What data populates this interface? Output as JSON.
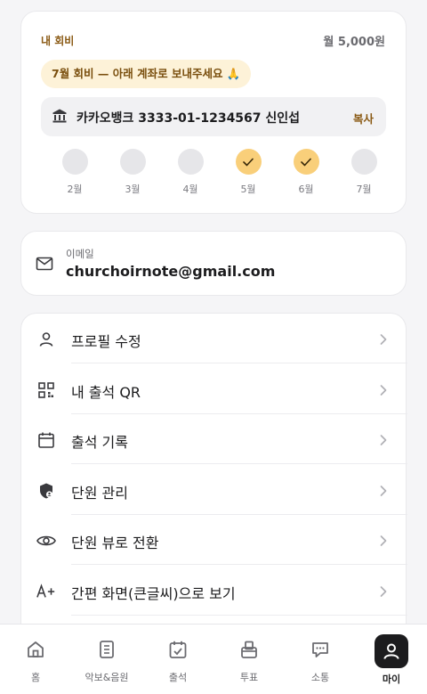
{
  "dues": {
    "title": "내 회비",
    "amount": "월 5,000원",
    "notice": "7월 회비 — 아래 계좌로 보내주세요 🙏",
    "account": "카카오뱅크 3333-01-1234567 신인섭",
    "copy_label": "복사",
    "months": [
      {
        "label": "2월",
        "paid": false
      },
      {
        "label": "3월",
        "paid": false
      },
      {
        "label": "4월",
        "paid": false
      },
      {
        "label": "5월",
        "paid": true
      },
      {
        "label": "6월",
        "paid": true
      },
      {
        "label": "7월",
        "paid": false
      }
    ],
    "accent_color": "#8a5a14",
    "paid_color": "#f9cf7a"
  },
  "email": {
    "label": "이메일",
    "value": "churchoirnote@gmail.com"
  },
  "menu": [
    {
      "label": "프로필 수정",
      "icon": "person-icon"
    },
    {
      "label": "내 출석 QR",
      "icon": "qr-code-icon"
    },
    {
      "label": "출석 기록",
      "icon": "calendar-icon"
    },
    {
      "label": "단원 관리",
      "icon": "shield-user-icon"
    },
    {
      "label": "단원 뷰로 전환",
      "icon": "eye-icon"
    },
    {
      "label": "간편 화면(큰글씨)으로 보기",
      "icon": "text-size-icon"
    }
  ],
  "tabs": [
    {
      "label": "홈",
      "icon": "home-icon"
    },
    {
      "label": "악보&음원",
      "icon": "score-book-icon"
    },
    {
      "label": "출석",
      "icon": "calendar-check-icon"
    },
    {
      "label": "투표",
      "icon": "ballot-box-icon"
    },
    {
      "label": "소통",
      "icon": "chat-bubble-icon"
    },
    {
      "label": "마이",
      "icon": "my-profile-icon",
      "active": true
    }
  ]
}
